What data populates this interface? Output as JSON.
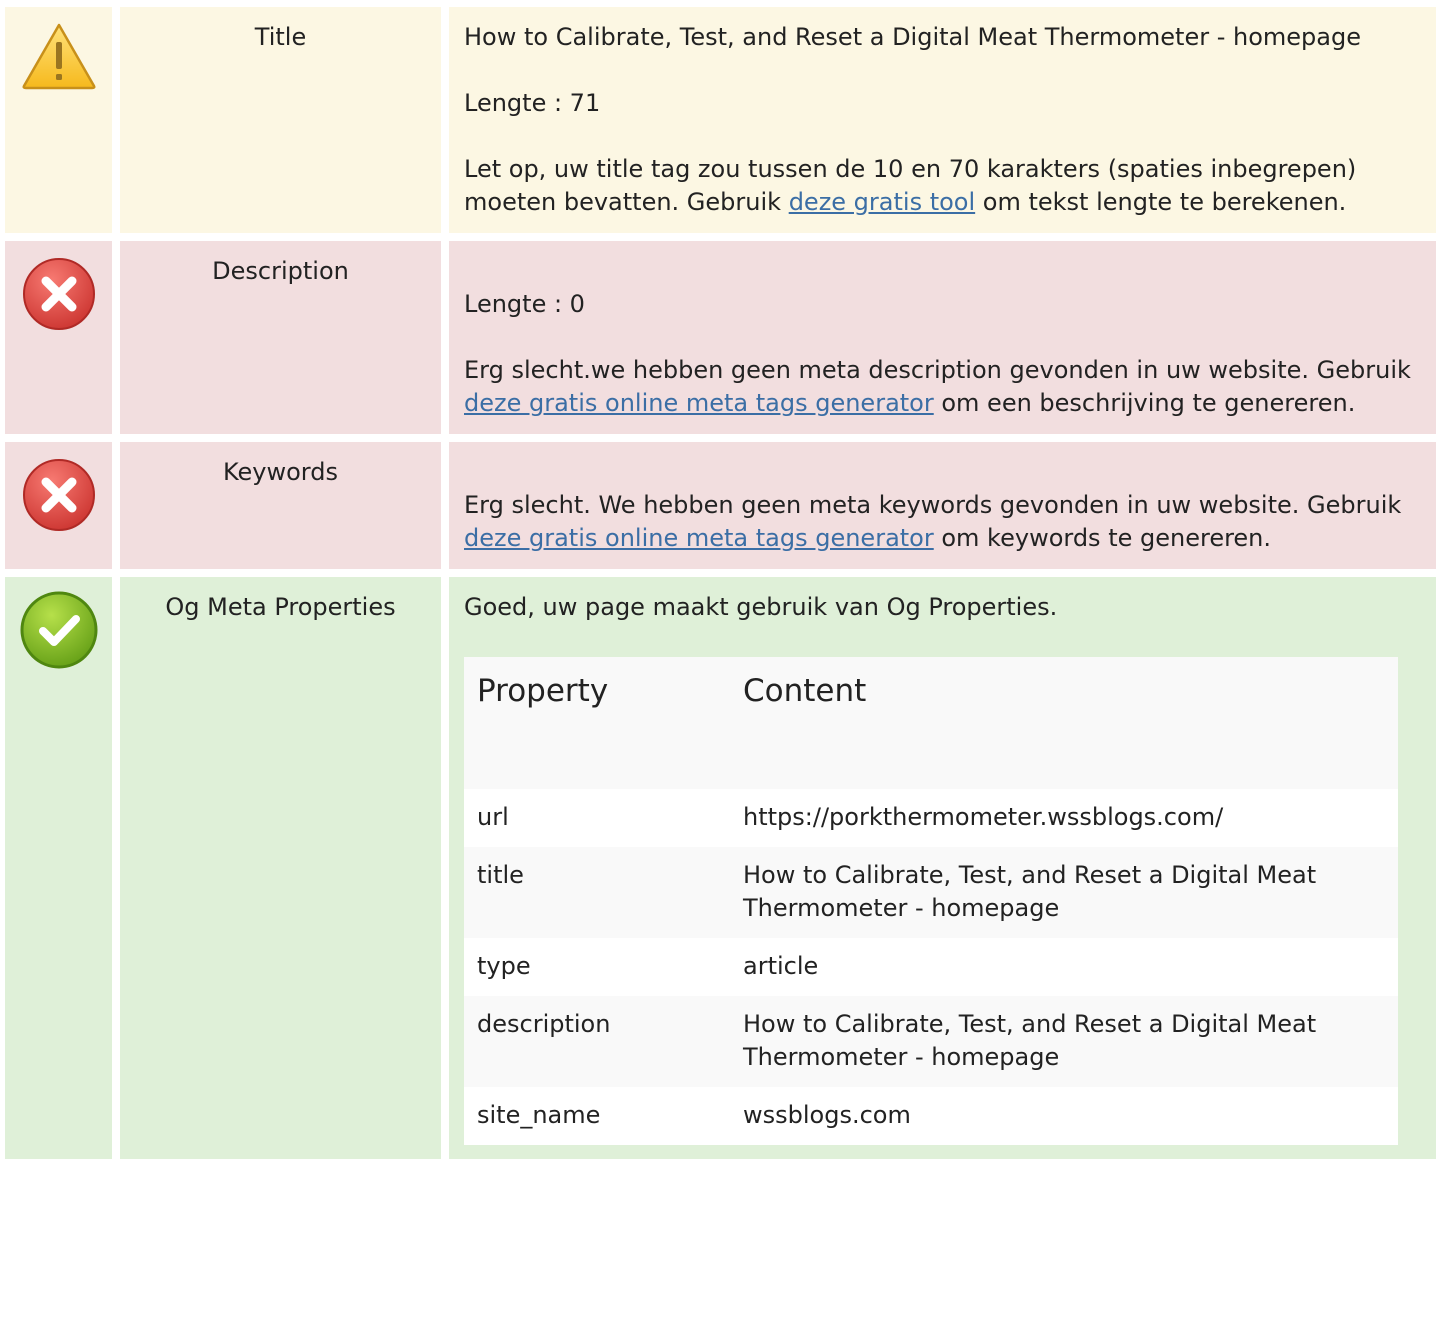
{
  "rows": {
    "title": {
      "name": "Title",
      "status_icon": "warning-icon",
      "value": "How to Calibrate, Test, and Reset a Digital Meat Thermometer - homepage",
      "length_text": "Lengte : 71",
      "advice_before": "Let op, uw title tag zou tussen de 10 en 70 karakters (spaties inbegrepen) moeten bevatten. Gebruik ",
      "advice_link": "deze gratis tool",
      "advice_after": " om tekst lengte te berekenen."
    },
    "description": {
      "name": "Description",
      "status_icon": "error-icon",
      "length_text": "Lengte : 0",
      "advice_before": "Erg slecht.we hebben geen meta description gevonden in uw website. Gebruik ",
      "advice_link": "deze gratis online meta tags generator",
      "advice_after": " om een beschrijving te genereren."
    },
    "keywords": {
      "name": "Keywords",
      "status_icon": "error-icon",
      "advice_before": "Erg slecht. We hebben geen meta keywords gevonden in uw website. Gebruik ",
      "advice_link": "deze gratis online meta tags generator",
      "advice_after": " om keywords te genereren."
    },
    "og": {
      "name": "Og Meta Properties",
      "status_icon": "success-icon",
      "summary": "Goed, uw page maakt gebruik van Og Properties.",
      "table": {
        "headers": [
          "Property",
          "Content"
        ],
        "rows": [
          {
            "property": "url",
            "content": "https://porkthermometer.wssblogs.com/"
          },
          {
            "property": "title",
            "content": "How to Calibrate, Test, and Reset a Digital Meat Thermometer - homepage"
          },
          {
            "property": "type",
            "content": "article"
          },
          {
            "property": "description",
            "content": "How to Calibrate, Test, and Reset a Digital Meat Thermometer - homepage"
          },
          {
            "property": "site_name",
            "content": "wssblogs.com"
          }
        ]
      }
    }
  },
  "colors": {
    "warning_bg": "#fcf7e3",
    "error_bg": "#f2dedf",
    "success_bg": "#dff0d8",
    "link": "#3b6ea5"
  }
}
